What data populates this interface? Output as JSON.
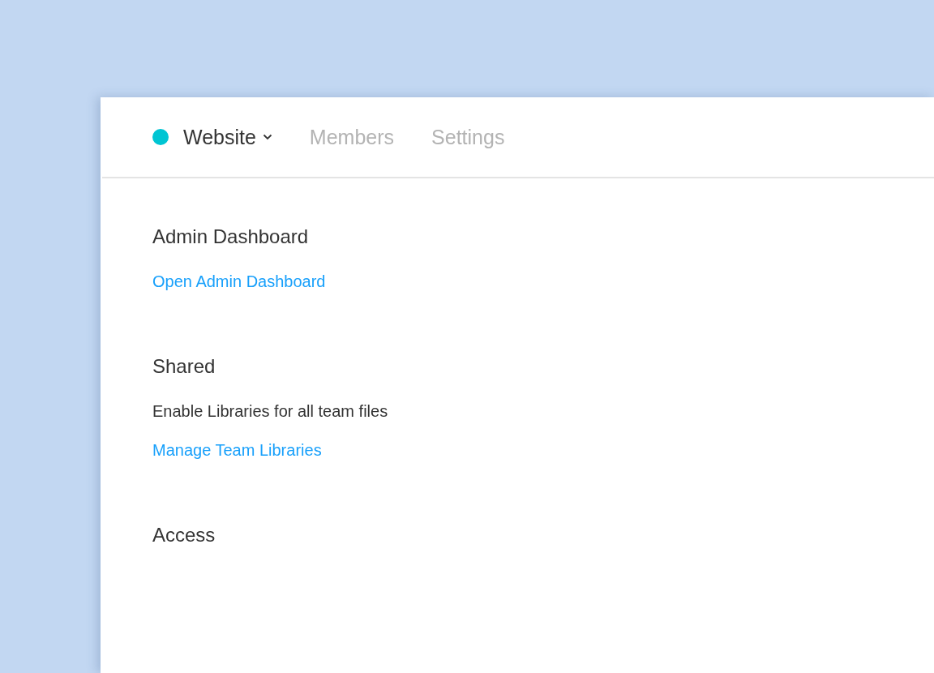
{
  "team": {
    "color": "#00c5d3"
  },
  "tabs": [
    {
      "label": "Website",
      "selected": true,
      "dropdown": true
    },
    {
      "label": "Members",
      "selected": false,
      "dropdown": false
    },
    {
      "label": "Settings",
      "selected": false,
      "dropdown": false
    }
  ],
  "sections": [
    {
      "title": "Admin Dashboard",
      "items": [
        {
          "kind": "link",
          "text": "Open Admin Dashboard"
        }
      ]
    },
    {
      "title": "Shared",
      "items": [
        {
          "kind": "text",
          "text": "Enable Libraries for all team files"
        },
        {
          "kind": "link",
          "text": "Manage Team Libraries"
        }
      ]
    },
    {
      "title": "Access"
    }
  ]
}
